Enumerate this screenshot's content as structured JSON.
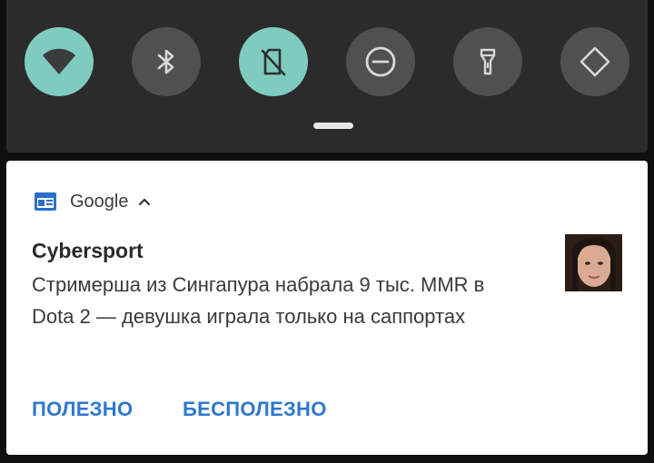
{
  "quick_settings": {
    "tiles": [
      {
        "icon": "wifi-icon",
        "active": true
      },
      {
        "icon": "bluetooth-icon",
        "active": false
      },
      {
        "icon": "sim-card-off-icon",
        "active": true
      },
      {
        "icon": "do-not-disturb-icon",
        "active": false
      },
      {
        "icon": "flashlight-icon",
        "active": false
      },
      {
        "icon": "auto-rotate-icon",
        "active": false
      }
    ],
    "active_color": "#7fcbc0",
    "inactive_color": "#505050"
  },
  "notification": {
    "app_name": "Google",
    "title": "Cybersport",
    "body": "Стримерша из Сингапура набрала 9 тыс. MMR в Dota 2 — девушка играла только на саппортах",
    "actions": [
      {
        "label": "ПОЛЕЗНО"
      },
      {
        "label": "БЕСПОЛЕЗНО"
      }
    ],
    "accent_color": "#2f77cf"
  }
}
